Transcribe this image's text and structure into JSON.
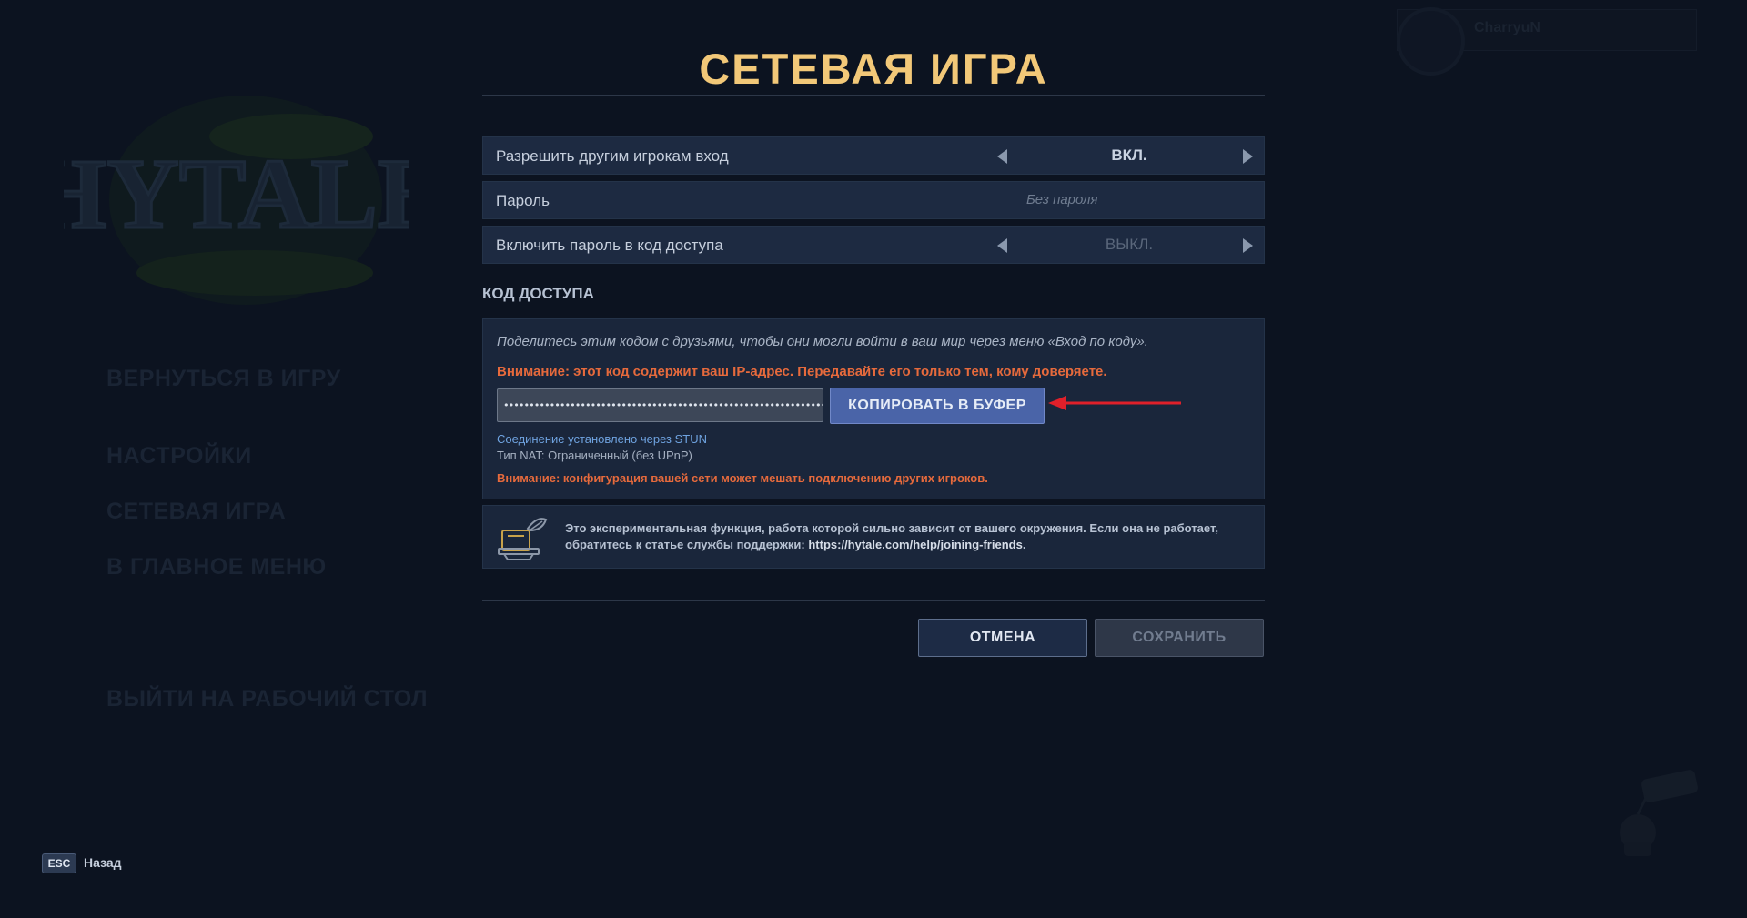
{
  "background_menu": {
    "logo_text": "HYTALE",
    "items": [
      "ВЕРНУТЬСЯ В ИГРУ",
      "НАСТРОЙКИ",
      "СЕТЕВАЯ ИГРА",
      "В ГЛАВНОЕ МЕНЮ",
      "ВЫЙТИ НА РАБОЧИЙ СТОЛ"
    ]
  },
  "profile": {
    "name": "CharryuN"
  },
  "dialog": {
    "title": "СЕТЕВАЯ ИГРА",
    "settings": [
      {
        "label": "Разрешить другим игрокам вход",
        "value": "ВКЛ."
      },
      {
        "label": "Пароль",
        "placeholder": "Без пароля"
      },
      {
        "label": "Включить пароль в код доступа",
        "value": "ВЫКЛ."
      }
    ],
    "access_code": {
      "section_title": "КОД ДОСТУПА",
      "info": "Поделитесь этим кодом с друзьями, чтобы они могли войти в ваш мир через меню «Вход по коду».",
      "ip_warning": "Внимание: этот код содержит ваш IP-адрес. Передавайте его только тем, кому доверяете.",
      "code_masked": "••••••••••••••••••••••••••••••••••••••••••••••••••••••••••••••••••••••••••••••••••",
      "copy_button": "КОПИРОВАТЬ В БУФЕР",
      "stun_status": "Соединение установлено через STUN",
      "nat_type": "Тип NAT: Ограниченный (без UPnP)",
      "network_warning": "Внимание: конфигурация вашей сети может мешать подключению других игроков."
    },
    "experimental": {
      "text": "Это экспериментальная функция, работа которой сильно зависит от вашего окружения. Если она не работает, обратитесь к статье службы поддержки: ",
      "link": "https://hytale.com/help/joining-friends",
      "suffix": "."
    },
    "buttons": {
      "cancel": "ОТМЕНА",
      "save": "СОХРАНИТЬ"
    }
  },
  "footer": {
    "key": "ESC",
    "label": "Назад"
  },
  "colors": {
    "title": "#f2c878",
    "warning": "#e66a3c",
    "link_blue": "#6fa3e0",
    "accent_button": "#4a64a8",
    "annotation_arrow": "#e0202a"
  }
}
